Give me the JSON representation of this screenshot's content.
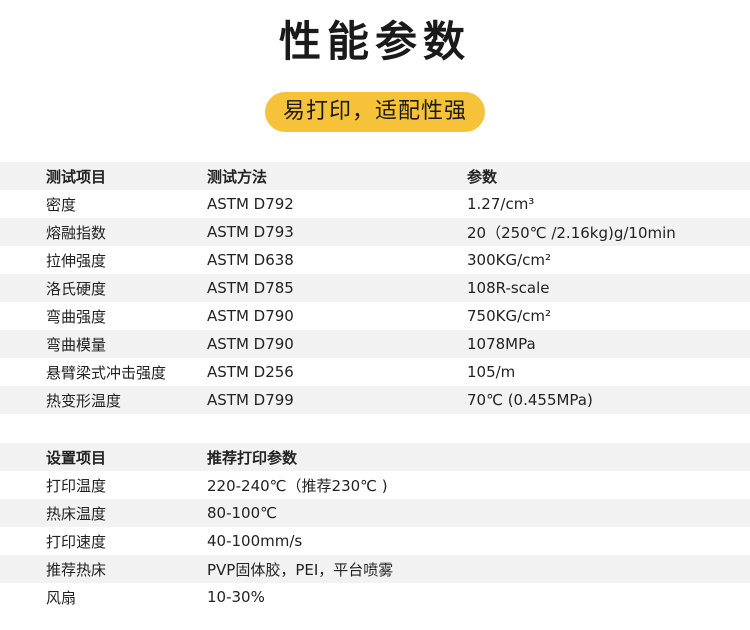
{
  "title": "性能参数",
  "badge": "易打印，适配性强",
  "performance": {
    "headers": [
      "测试项目",
      "测试方法",
      "参数"
    ],
    "rows": [
      [
        "密度",
        "ASTM D792",
        "1.27/cm³"
      ],
      [
        "熔融指数",
        "ASTM D793",
        "20（250℃ /2.16kg)g/10min"
      ],
      [
        "拉伸强度",
        "ASTM D638",
        "300KG/cm²"
      ],
      [
        "洛氏硬度",
        "ASTM D785",
        "108R-scale"
      ],
      [
        "弯曲强度",
        "ASTM D790",
        "750KG/cm²"
      ],
      [
        "弯曲模量",
        "ASTM D790",
        "1078MPa"
      ],
      [
        "悬臂梁式冲击强度",
        "ASTM D256",
        "105/m"
      ],
      [
        "热变形温度",
        "ASTM D799",
        "70℃ (0.455MPa)"
      ]
    ]
  },
  "settings": {
    "headers": [
      "设置项目",
      "推荐打印参数"
    ],
    "rows": [
      [
        "打印温度",
        "220-240℃（推荐230℃ )"
      ],
      [
        "热床温度",
        "80-100℃"
      ],
      [
        "打印速度",
        "40-100mm/s"
      ],
      [
        "推荐热床",
        "PVP固体胶，PEI，平台喷雾"
      ],
      [
        "风扇",
        "10-30%"
      ]
    ]
  }
}
